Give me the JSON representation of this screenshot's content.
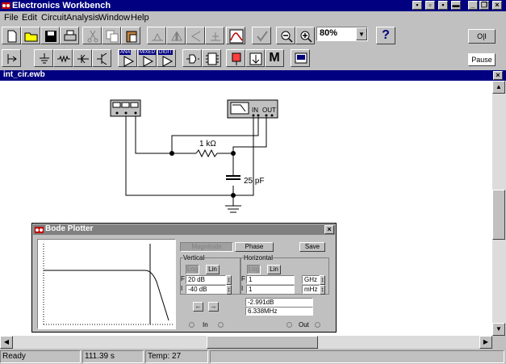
{
  "app": {
    "title": "Electronics Workbench"
  },
  "window_controls": [
    "restore",
    "minimize",
    "close"
  ],
  "menu": [
    {
      "label": "File"
    },
    {
      "label": "Edit"
    },
    {
      "label": "Circuit"
    },
    {
      "label": "Analysis"
    },
    {
      "label": "Window"
    },
    {
      "label": "Help"
    }
  ],
  "toolbar": {
    "zoom": "80%",
    "help_label": "?",
    "pause_label": "Pause",
    "power_label": "O|I",
    "m_label": "M",
    "parts_labels": [
      "ANA",
      "MIXED",
      "DIGIT"
    ]
  },
  "document": {
    "title": "int_cir.ewb"
  },
  "circuit": {
    "resistor_label": "1 kΩ",
    "capacitor_label": "25 pF",
    "plotter_in_label": "IN",
    "plotter_out_label": "OUT"
  },
  "bode": {
    "title": "Bode Plotter",
    "tab_magnitude": "Magnitude",
    "tab_phase": "Phase",
    "save_label": "Save",
    "vertical_label": "Vertical",
    "horizontal_label": "Horizontal",
    "log_label": "Log",
    "lin_label": "Lin",
    "f_label": "F",
    "i_label": "I",
    "v_final": "20",
    "v_final_unit": "dB",
    "v_initial": "-40",
    "v_initial_unit": "dB",
    "h_final": "1",
    "h_final_unit": "GHz",
    "h_initial": "1",
    "h_initial_unit": "mHz",
    "readout_db": "-2.991dB",
    "readout_freq": "6.338MHz",
    "in_label": "In",
    "out_label": "Out"
  },
  "status": {
    "ready": "Ready",
    "time": "111.39 s",
    "temp": "Temp:  27"
  }
}
